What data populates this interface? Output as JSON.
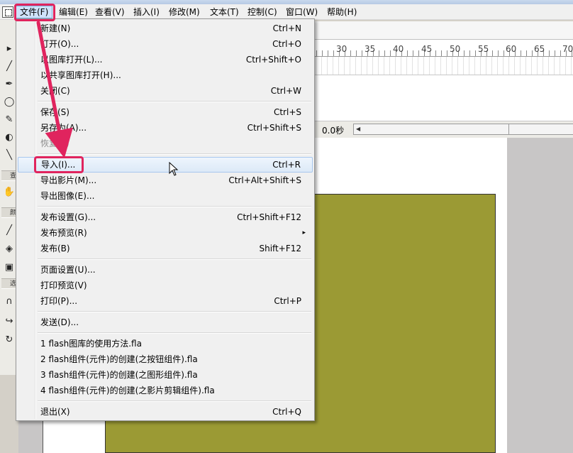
{
  "menubar": {
    "items": [
      {
        "label": "文件(F)"
      },
      {
        "label": "编辑(E)"
      },
      {
        "label": "查看(V)"
      },
      {
        "label": "插入(I)"
      },
      {
        "label": "修改(M)"
      },
      {
        "label": "文本(T)"
      },
      {
        "label": "控制(C)"
      },
      {
        "label": "窗口(W)"
      },
      {
        "label": "帮助(H)"
      }
    ]
  },
  "file_menu": {
    "items": [
      {
        "label": "新建(N)",
        "shortcut": "Ctrl+N"
      },
      {
        "label": "打开(O)...",
        "shortcut": "Ctrl+O"
      },
      {
        "label": "以图库打开(L)...",
        "shortcut": "Ctrl+Shift+O"
      },
      {
        "label": "以共享图库打开(H)...",
        "shortcut": ""
      },
      {
        "label": "关闭(C)",
        "shortcut": "Ctrl+W"
      },
      {
        "label": "保存(S)",
        "shortcut": "Ctrl+S"
      },
      {
        "label": "另存为(A)...",
        "shortcut": "Ctrl+Shift+S"
      },
      {
        "label": "恢复(T)",
        "shortcut": ""
      },
      {
        "label": "导入(I)...",
        "shortcut": "Ctrl+R"
      },
      {
        "label": "导出影片(M)...",
        "shortcut": "Ctrl+Alt+Shift+S"
      },
      {
        "label": "导出图像(E)...",
        "shortcut": ""
      },
      {
        "label": "发布设置(G)...",
        "shortcut": "Ctrl+Shift+F12"
      },
      {
        "label": "发布预览(R)",
        "shortcut": ""
      },
      {
        "label": "发布(B)",
        "shortcut": "Shift+F12"
      },
      {
        "label": "页面设置(U)...",
        "shortcut": ""
      },
      {
        "label": "打印预览(V)",
        "shortcut": ""
      },
      {
        "label": "打印(P)...",
        "shortcut": "Ctrl+P"
      },
      {
        "label": "发送(D)...",
        "shortcut": ""
      },
      {
        "label": "1 flash图库的使用方法.fla",
        "shortcut": ""
      },
      {
        "label": "2 flash组件(元件)的创建(之按钮组件).fla",
        "shortcut": ""
      },
      {
        "label": "3 flash组件(元件)的创建(之图形组件).fla",
        "shortcut": ""
      },
      {
        "label": "4 flash组件(元件)的创建(之影片剪辑组件).fla",
        "shortcut": ""
      },
      {
        "label": "退出(X)",
        "shortcut": "Ctrl+Q"
      }
    ],
    "submenu_arrow": "▸"
  },
  "timeline": {
    "ruler": [
      "30",
      "35",
      "40",
      "45",
      "50",
      "55",
      "60",
      "65",
      "70"
    ],
    "time": "0.0秒"
  },
  "tools": {
    "section_labels": [
      "查",
      "颜",
      "选"
    ]
  },
  "colors": {
    "stage_fill": "#9b9a34",
    "annotation": "#e0245e",
    "menu_bg": "#f0f0f0"
  }
}
